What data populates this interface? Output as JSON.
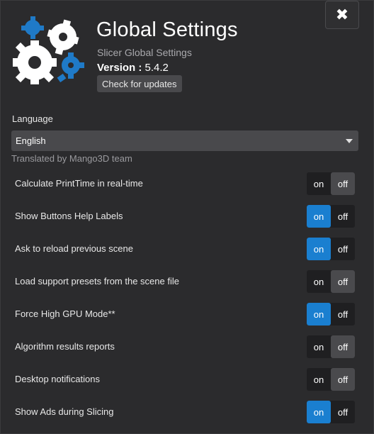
{
  "header": {
    "title": "Global Settings",
    "subtitle": "Slicer Global Settings",
    "version_label": "Version :",
    "version_value": "5.4.2",
    "update_button": "Check for updates",
    "close_glyph": "✖"
  },
  "language": {
    "label": "Language",
    "selected": "English",
    "translated_by": "Translated by Mango3D team"
  },
  "toggle_labels": {
    "on": "on",
    "off": "off"
  },
  "settings": [
    {
      "label": "Calculate PrintTime in real-time",
      "state": "off"
    },
    {
      "label": "Show Buttons Help Labels",
      "state": "on"
    },
    {
      "label": "Ask to reload previous scene",
      "state": "on"
    },
    {
      "label": "Load support presets from the scene file",
      "state": "off"
    },
    {
      "label": "Force High GPU Mode**",
      "state": "on"
    },
    {
      "label": "Algorithm results reports",
      "state": "off"
    },
    {
      "label": "Desktop notifications",
      "state": "off"
    },
    {
      "label": "Show Ads during Slicing",
      "state": "on"
    }
  ],
  "colors": {
    "background": "#2b2b2d",
    "accent_on": "#1a7fd0",
    "off_active": "#4a4a4d",
    "logo_blue": "#1f7ac7",
    "logo_white": "#ffffff"
  },
  "icons": {
    "logo": "gears-logo-icon",
    "close": "close-icon",
    "dropdown": "chevron-down-icon"
  }
}
